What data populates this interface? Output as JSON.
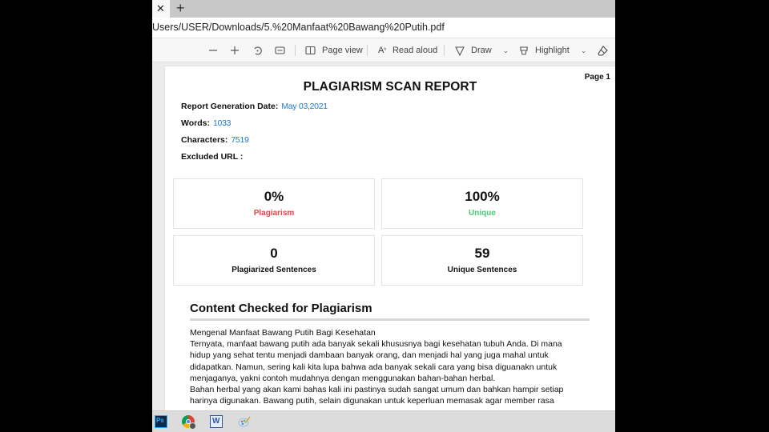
{
  "browser": {
    "tab_close_icon": "close-icon",
    "new_tab_icon": "plus-icon",
    "address": "Users/USER/Downloads/5.%20Manfaat%20Bawang%20Putih.pdf"
  },
  "pdf_toolbar": {
    "zoom_out_icon": "minus-icon",
    "zoom_in_icon": "plus-icon",
    "rotate_icon": "rotate-icon",
    "fit_icon": "fit-to-width-icon",
    "page_view_label": "Page view",
    "read_aloud_label": "Read aloud",
    "draw_label": "Draw",
    "highlight_label": "Highlight",
    "eraser_icon": "eraser-icon"
  },
  "report": {
    "page_label": "Page 1",
    "title": "PLAGIARISM SCAN REPORT",
    "meta": {
      "date_label": "Report Generation Date:",
      "date_value": "May 03,2021",
      "words_label": "Words:",
      "words_value": "1033",
      "characters_label": "Characters:",
      "characters_value": "7519",
      "excluded_label": "Excluded URL :"
    },
    "stats": {
      "plagiarism_value": "0%",
      "plagiarism_label": "Plagiarism",
      "unique_value": "100%",
      "unique_label": "Unique",
      "plag_sentences_value": "0",
      "plag_sentences_label": "Plagiarized Sentences",
      "unique_sentences_value": "59",
      "unique_sentences_label": "Unique Sentences"
    },
    "colors": {
      "plagiarism": "#dc4a4a",
      "unique": "#4cc878",
      "link_blue": "#1f77d4"
    },
    "section_title": "Content Checked for Plagiarism",
    "content_lines": [
      "Mengenal Manfaat Bawang Putih Bagi Kesehatan",
      "Ternyata, manfaat bawang putih ada banyak sekali khususnya bagi kesehatan tubuh Anda. Di mana",
      "hidup yang sehat tentu menjadi dambaan banyak orang, dan menjadi hal yang juga mahal untuk",
      "didapatkan. Namun, sering kali kita lupa bahwa ada banyak sekali cara yang bisa diguanakn untuk",
      "menjaganya, yakni contoh mudahnya dengan menggunakan bahan-bahan herbal.",
      "Bahan herbal yang akan kami bahas kali ini pastinya sudah sangat umum dan bahkan hampir setiap",
      "harinya digunakan. Bawang putih, selain digunakan untuk keperluan memasak agar member rasa"
    ]
  },
  "taskbar": {
    "apps": [
      "photoshop",
      "chrome",
      "word",
      "paint"
    ],
    "photoshop_label": "Ps",
    "word_label": "W"
  }
}
